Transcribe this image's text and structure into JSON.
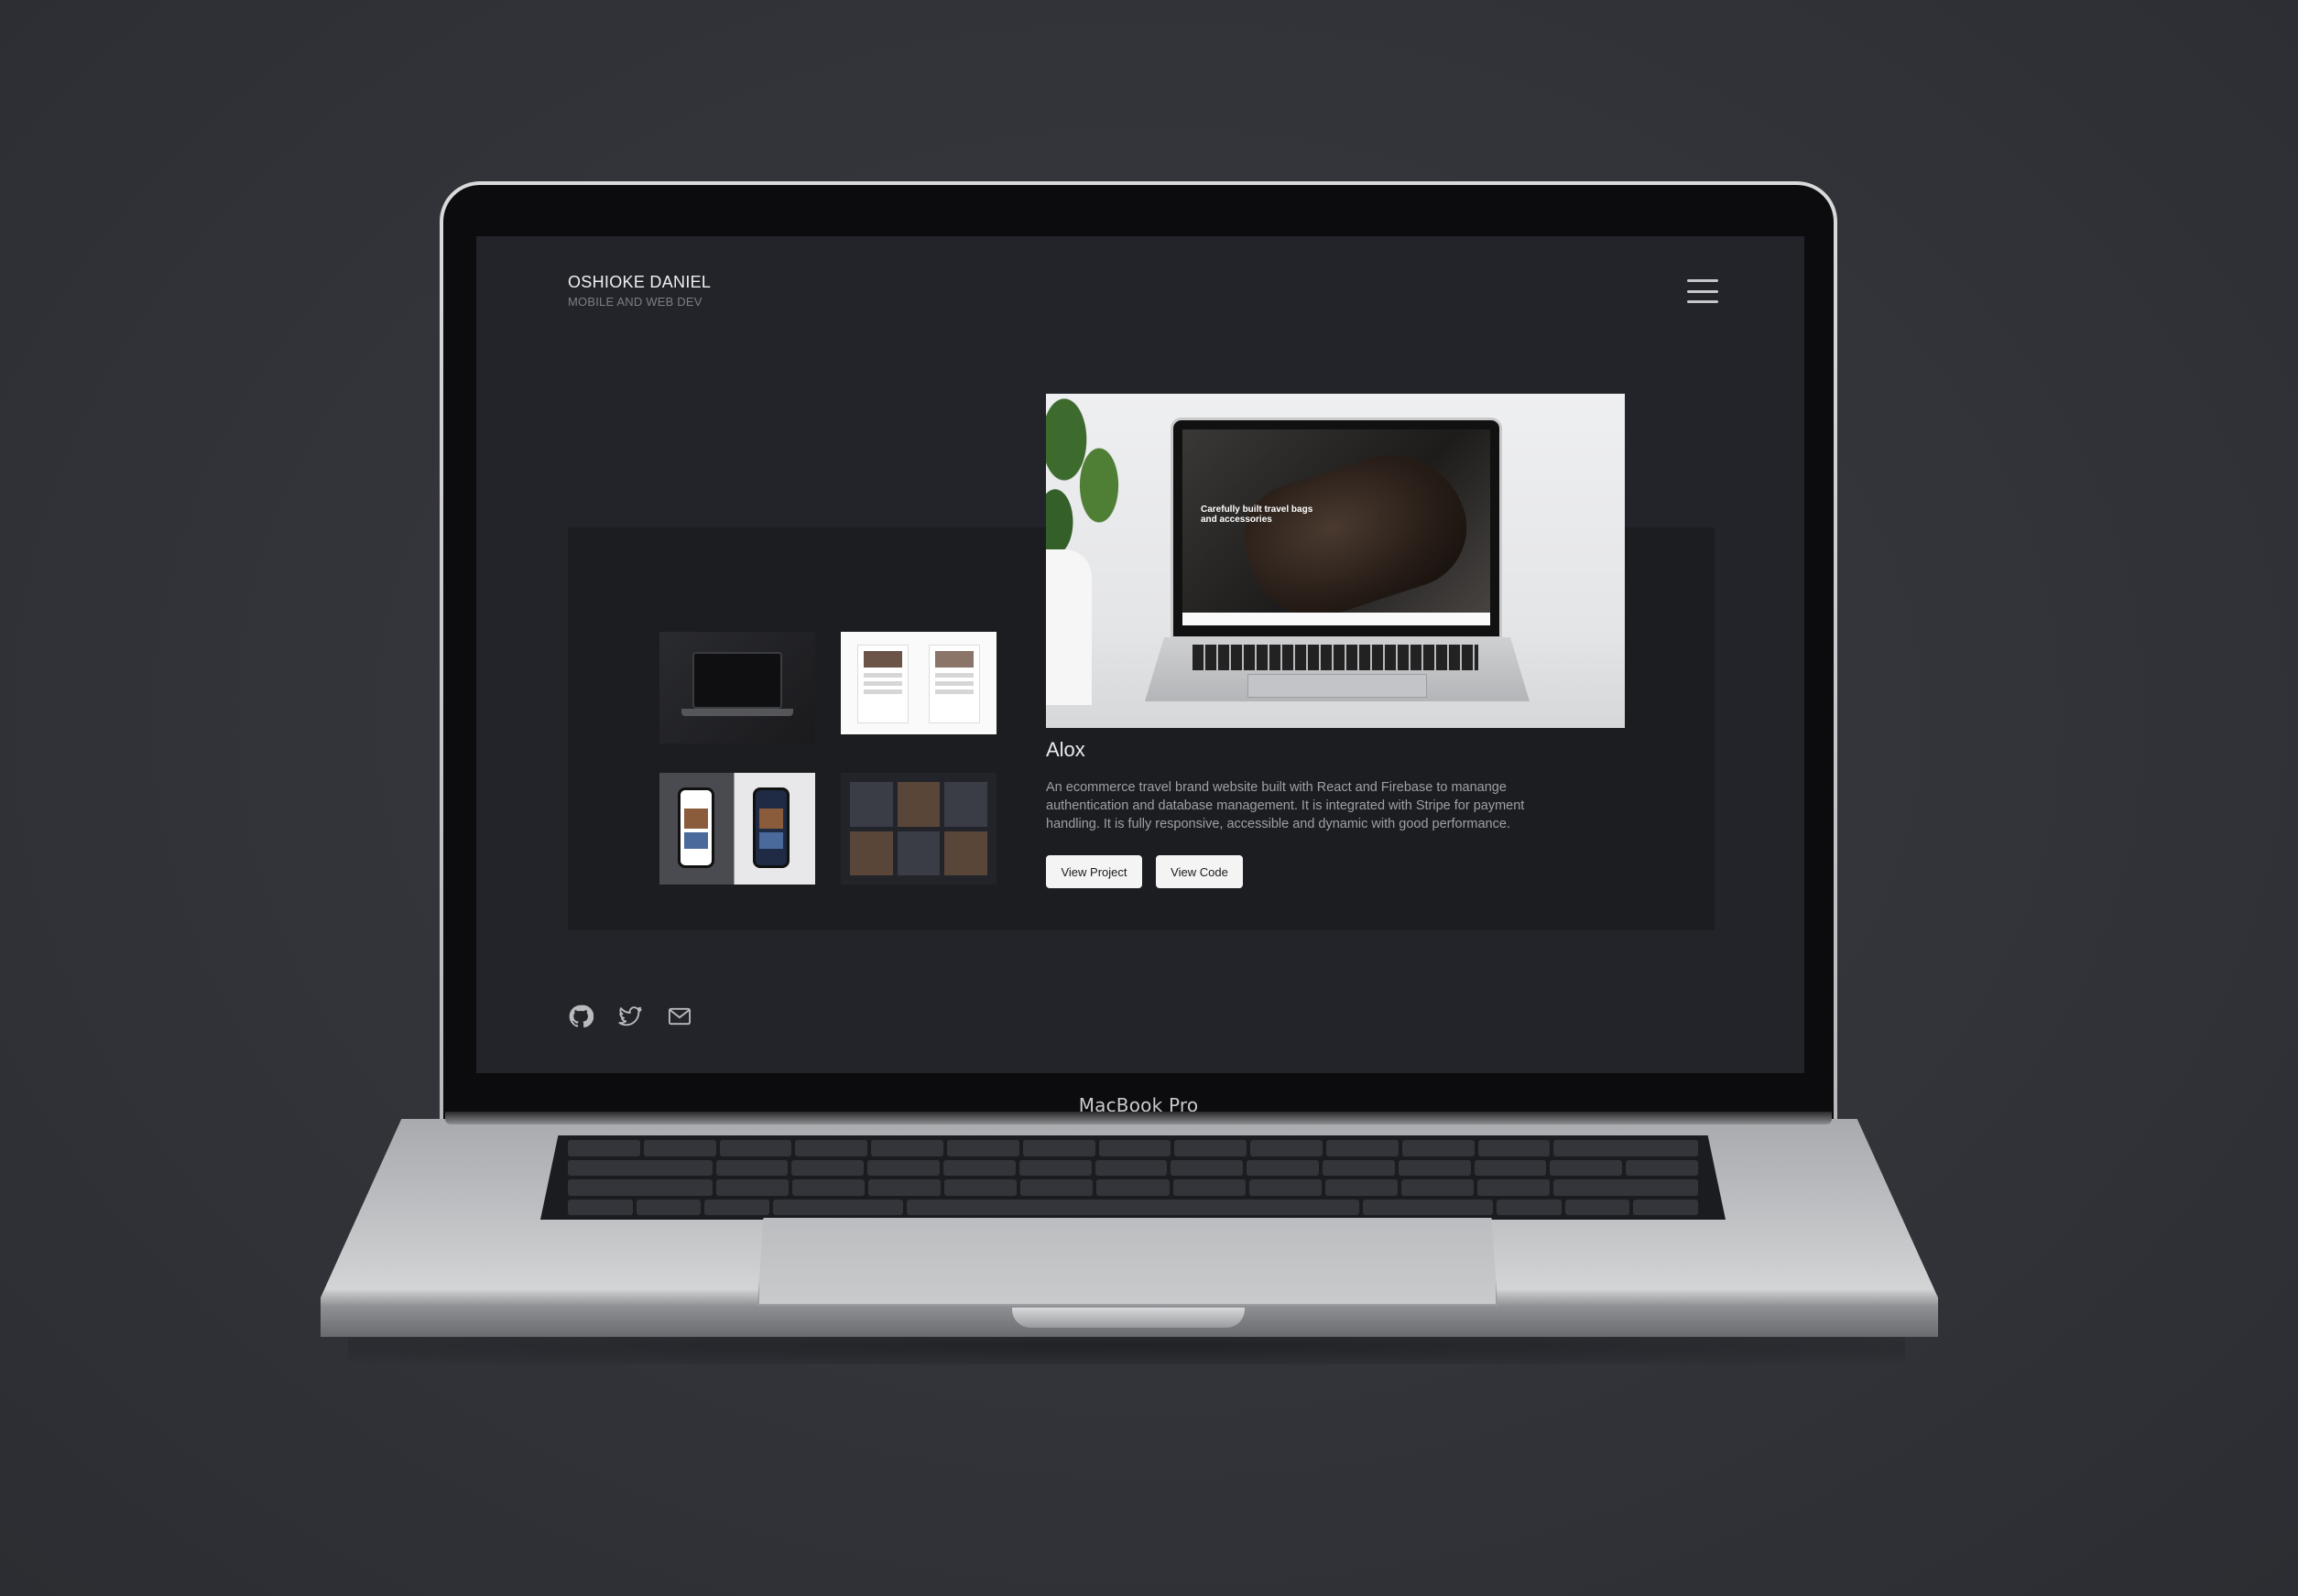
{
  "site": {
    "brand_name": "OSHIOKE DANIEL",
    "brand_subtitle": "MOBILE AND WEB DEV",
    "menu_icon": "hamburger-menu-icon"
  },
  "project": {
    "title": "Alox",
    "description": "An ecommerce travel brand website built with React and Firebase to manange authentication and database management. It is integrated with Stripe for payment handling. It is fully responsive, accessible and dynamic with good performance.",
    "hero_caption": "Carefully built travel bags and accessories",
    "buttons": {
      "view_project": "View Project",
      "view_code": "View Code"
    }
  },
  "thumbnails": [
    {
      "name": "laptop-mockup-thumbnail"
    },
    {
      "name": "pages-mockup-thumbnail"
    },
    {
      "name": "phones-mockup-thumbnail"
    },
    {
      "name": "collage-mockup-thumbnail"
    }
  ],
  "socials": [
    {
      "icon": "github-icon"
    },
    {
      "icon": "twitter-icon"
    },
    {
      "icon": "mail-icon"
    }
  ],
  "device": {
    "label": "MacBook Pro"
  },
  "colors": {
    "background": "#33353b",
    "screen": "#23242a",
    "panel": "#1c1d21",
    "button": "#f4f4f5",
    "text_primary": "#f0f0f2",
    "text_muted": "#9ea0a6"
  }
}
